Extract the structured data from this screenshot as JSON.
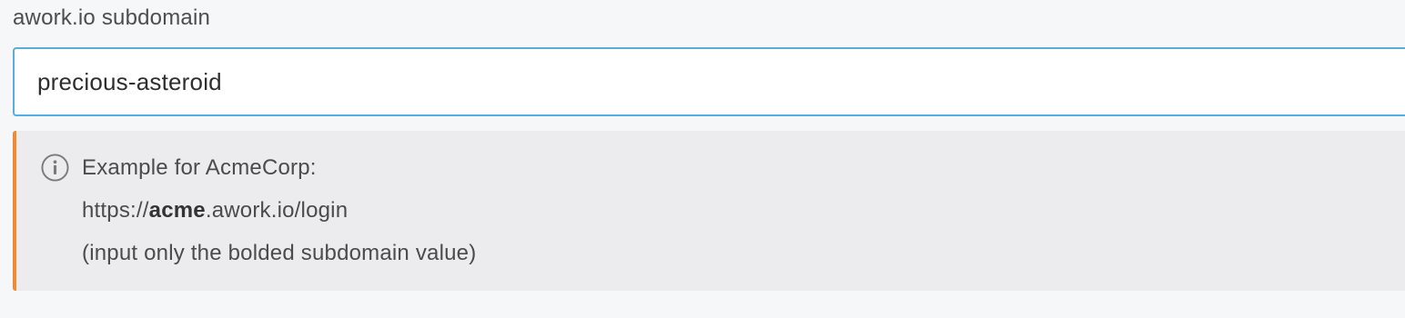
{
  "field": {
    "label": "awork.io subdomain",
    "value": "precious-asteroid",
    "placeholder": ""
  },
  "info": {
    "icon": "info-circle-icon",
    "accent_color": "#f08a36",
    "heading": "Example for AcmeCorp:",
    "url_prefix": "https://",
    "url_subdomain": "acme",
    "url_suffix": ".awork.io/login",
    "hint": "(input only the bolded subdomain value)"
  },
  "colors": {
    "input_border": "#55aee0",
    "info_background": "#ececee",
    "page_background": "#f6f7f9"
  }
}
